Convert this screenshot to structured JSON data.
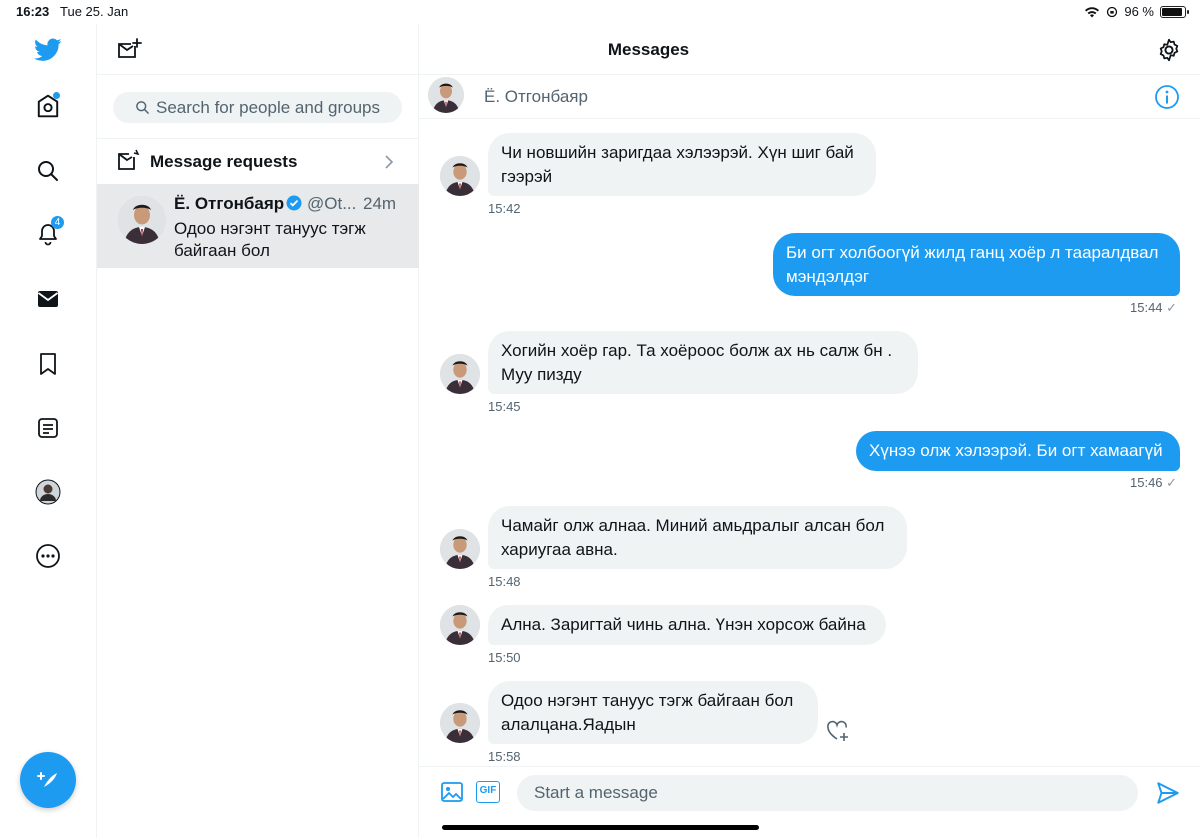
{
  "statusbar": {
    "time": "16:23",
    "date": "Tue 25. Jan",
    "battery": "96 %",
    "battery_level": 0.96
  },
  "rail": {
    "notifications_badge": "4"
  },
  "header": {
    "title": "Messages"
  },
  "search": {
    "placeholder": "Search for people and groups"
  },
  "requests": {
    "label": "Message requests"
  },
  "conversation": {
    "name": "Ё. Отгонбаяр",
    "handle": "@Ot...",
    "time": "24m",
    "preview": "Одоо нэгэнт тануус тэгж байгаан бол"
  },
  "chat": {
    "name": "Ё. Отгонбаяр",
    "messages": [
      {
        "dir": "in",
        "text": "Чи новшийн заригдаа хэлээрэй. Хүн шиг бай гээрэй",
        "time": "15:42"
      },
      {
        "dir": "out",
        "text": "Би огт холбоогүй жилд ганц хоёр л тааралдвал мэндэлдэг",
        "time": "15:44"
      },
      {
        "dir": "in",
        "text": "Хогийн хоёр гар. Та хоёроос  болж ах нь салж бн . Муу пизду",
        "time": "15:45"
      },
      {
        "dir": "out",
        "text": "Хүнээ олж хэлээрэй. Би огт хамаагүй",
        "time": "15:46"
      },
      {
        "dir": "in",
        "text": "Чамайг олж алнаа. Миний амьдралыг алсан бол хариугаа авна.",
        "time": "15:48"
      },
      {
        "dir": "in",
        "text": "Ална. Заригтай чинь ална. Үнэн хорсож байна",
        "time": "15:50"
      },
      {
        "dir": "in",
        "text": "Одоо нэгэнт тануус тэгж байгаан бол алалцана.Яадын",
        "time": "15:58"
      }
    ],
    "read_mark": "✓"
  },
  "composer": {
    "placeholder": "Start a message",
    "gif_label": "GIF"
  },
  "colors": {
    "accent": "#1d9bf0",
    "bubble_in": "#eff3f4",
    "selected_row": "#e7e9ea"
  }
}
